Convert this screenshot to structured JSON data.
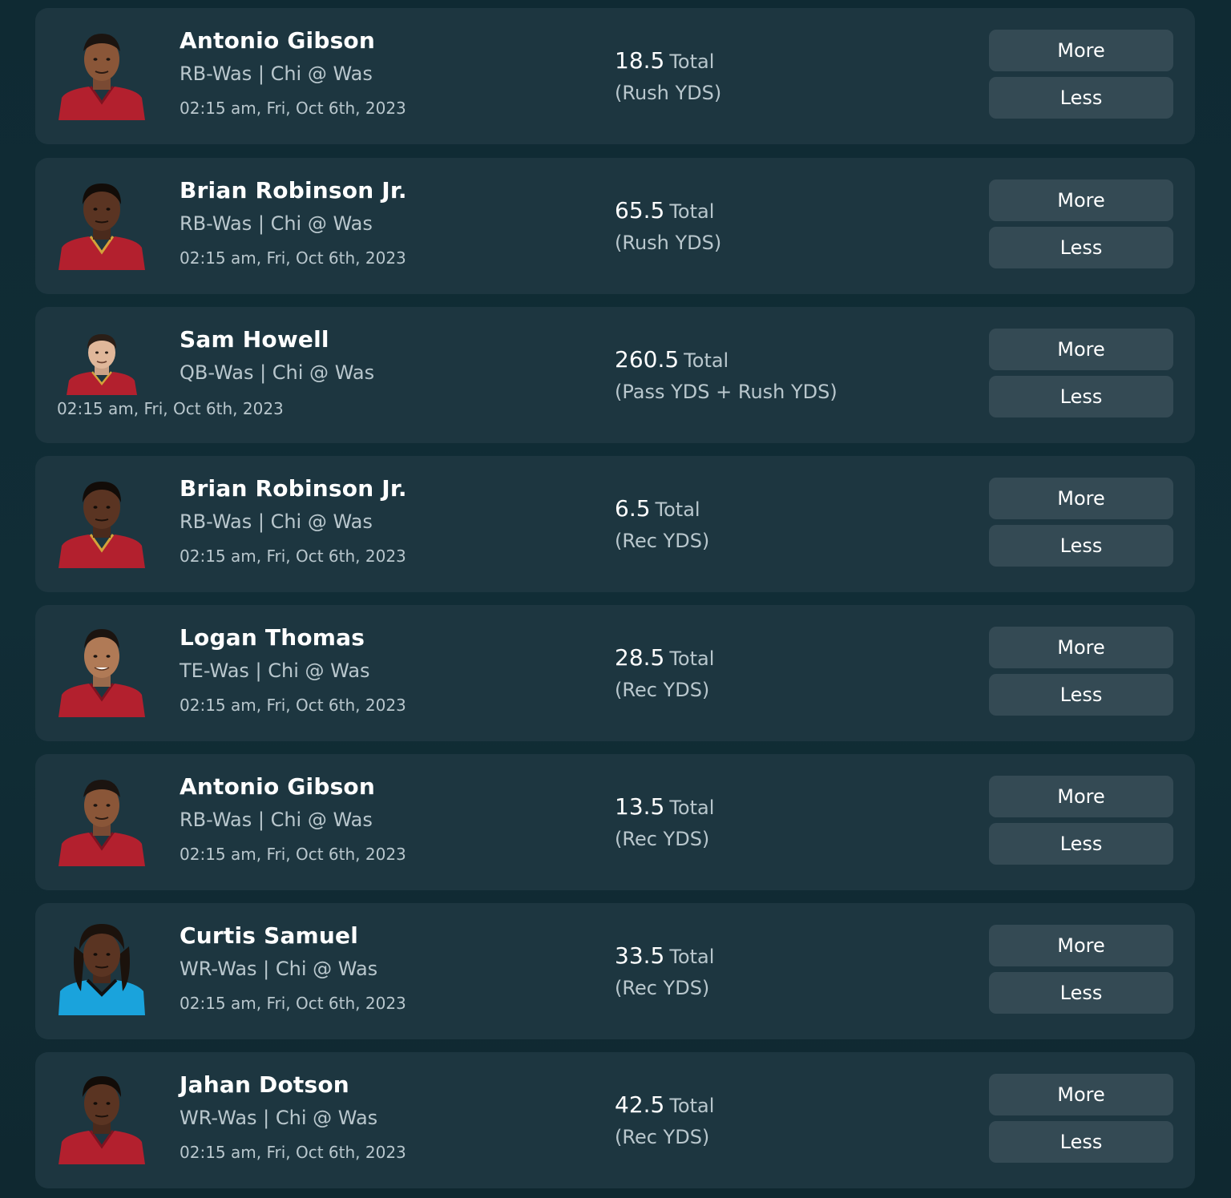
{
  "props": [
    {
      "name": "Antonio Gibson",
      "team": "RB-Was | Chi @ Was",
      "time": "02:15 am, Fri, Oct 6th, 2023",
      "line": "18.5",
      "total_label": "Total",
      "stat_type": "(Rush YDS)",
      "more_label": "More",
      "less_label": "Less",
      "jersey_color": "#b3202e"
    },
    {
      "name": "Brian Robinson Jr.",
      "team": "RB-Was | Chi @ Was",
      "time": "02:15 am, Fri, Oct 6th, 2023",
      "line": "65.5",
      "total_label": "Total",
      "stat_type": "(Rush YDS)",
      "more_label": "More",
      "less_label": "Less",
      "jersey_color": "#b3202e"
    },
    {
      "name": "Sam Howell",
      "team": "QB-Was | Chi @ Was",
      "time": "02:15 am, Fri, Oct 6th, 2023",
      "line": "260.5",
      "total_label": "Total",
      "stat_type": "(Pass YDS + Rush YDS)",
      "more_label": "More",
      "less_label": "Less",
      "jersey_color": "#b3202e"
    },
    {
      "name": "Brian Robinson Jr.",
      "team": "RB-Was | Chi @ Was",
      "time": "02:15 am, Fri, Oct 6th, 2023",
      "line": "6.5",
      "total_label": "Total",
      "stat_type": "(Rec YDS)",
      "more_label": "More",
      "less_label": "Less",
      "jersey_color": "#b3202e"
    },
    {
      "name": "Logan Thomas",
      "team": "TE-Was | Chi @ Was",
      "time": "02:15 am, Fri, Oct 6th, 2023",
      "line": "28.5",
      "total_label": "Total",
      "stat_type": "(Rec YDS)",
      "more_label": "More",
      "less_label": "Less",
      "jersey_color": "#b3202e"
    },
    {
      "name": "Antonio Gibson",
      "team": "RB-Was | Chi @ Was",
      "time": "02:15 am, Fri, Oct 6th, 2023",
      "line": "13.5",
      "total_label": "Total",
      "stat_type": "(Rec YDS)",
      "more_label": "More",
      "less_label": "Less",
      "jersey_color": "#b3202e"
    },
    {
      "name": "Curtis Samuel",
      "team": "WR-Was | Chi @ Was",
      "time": "02:15 am, Fri, Oct 6th, 2023",
      "line": "33.5",
      "total_label": "Total",
      "stat_type": "(Rec YDS)",
      "more_label": "More",
      "less_label": "Less",
      "jersey_color": "#1aa3dc"
    },
    {
      "name": "Jahan Dotson",
      "team": "WR-Was | Chi @ Was",
      "time": "02:15 am, Fri, Oct 6th, 2023",
      "line": "42.5",
      "total_label": "Total",
      "stat_type": "(Rec YDS)",
      "more_label": "More",
      "less_label": "Less",
      "jersey_color": "#b3202e"
    }
  ],
  "theme": {
    "card_bg": "#1d3640",
    "button_bg": "#344a54",
    "text_primary": "#ffffff",
    "text_secondary": "#b9c7cd"
  }
}
